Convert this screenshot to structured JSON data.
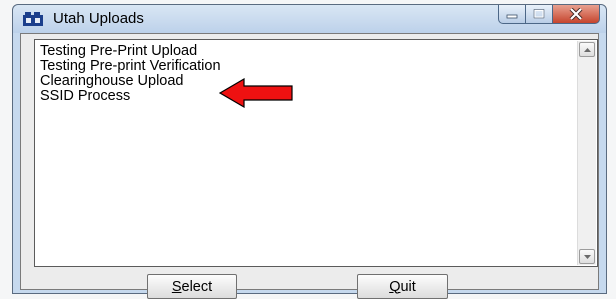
{
  "window": {
    "title": "Utah Uploads",
    "icon": "app-window-icon"
  },
  "list": {
    "items": [
      "Testing Pre-Print Upload",
      "Testing Pre-print Verification",
      "Clearinghouse Upload",
      "SSID Process"
    ]
  },
  "buttons": {
    "select": {
      "mnemonic": "S",
      "rest": "elect"
    },
    "quit": {
      "mnemonic": "Q",
      "rest": "uit"
    }
  },
  "annotation": {
    "icon": "red-arrow-icon",
    "color": "#ee1111"
  },
  "colors": {
    "titlebar": "#c6d9ee",
    "close_button": "#c6442d"
  }
}
